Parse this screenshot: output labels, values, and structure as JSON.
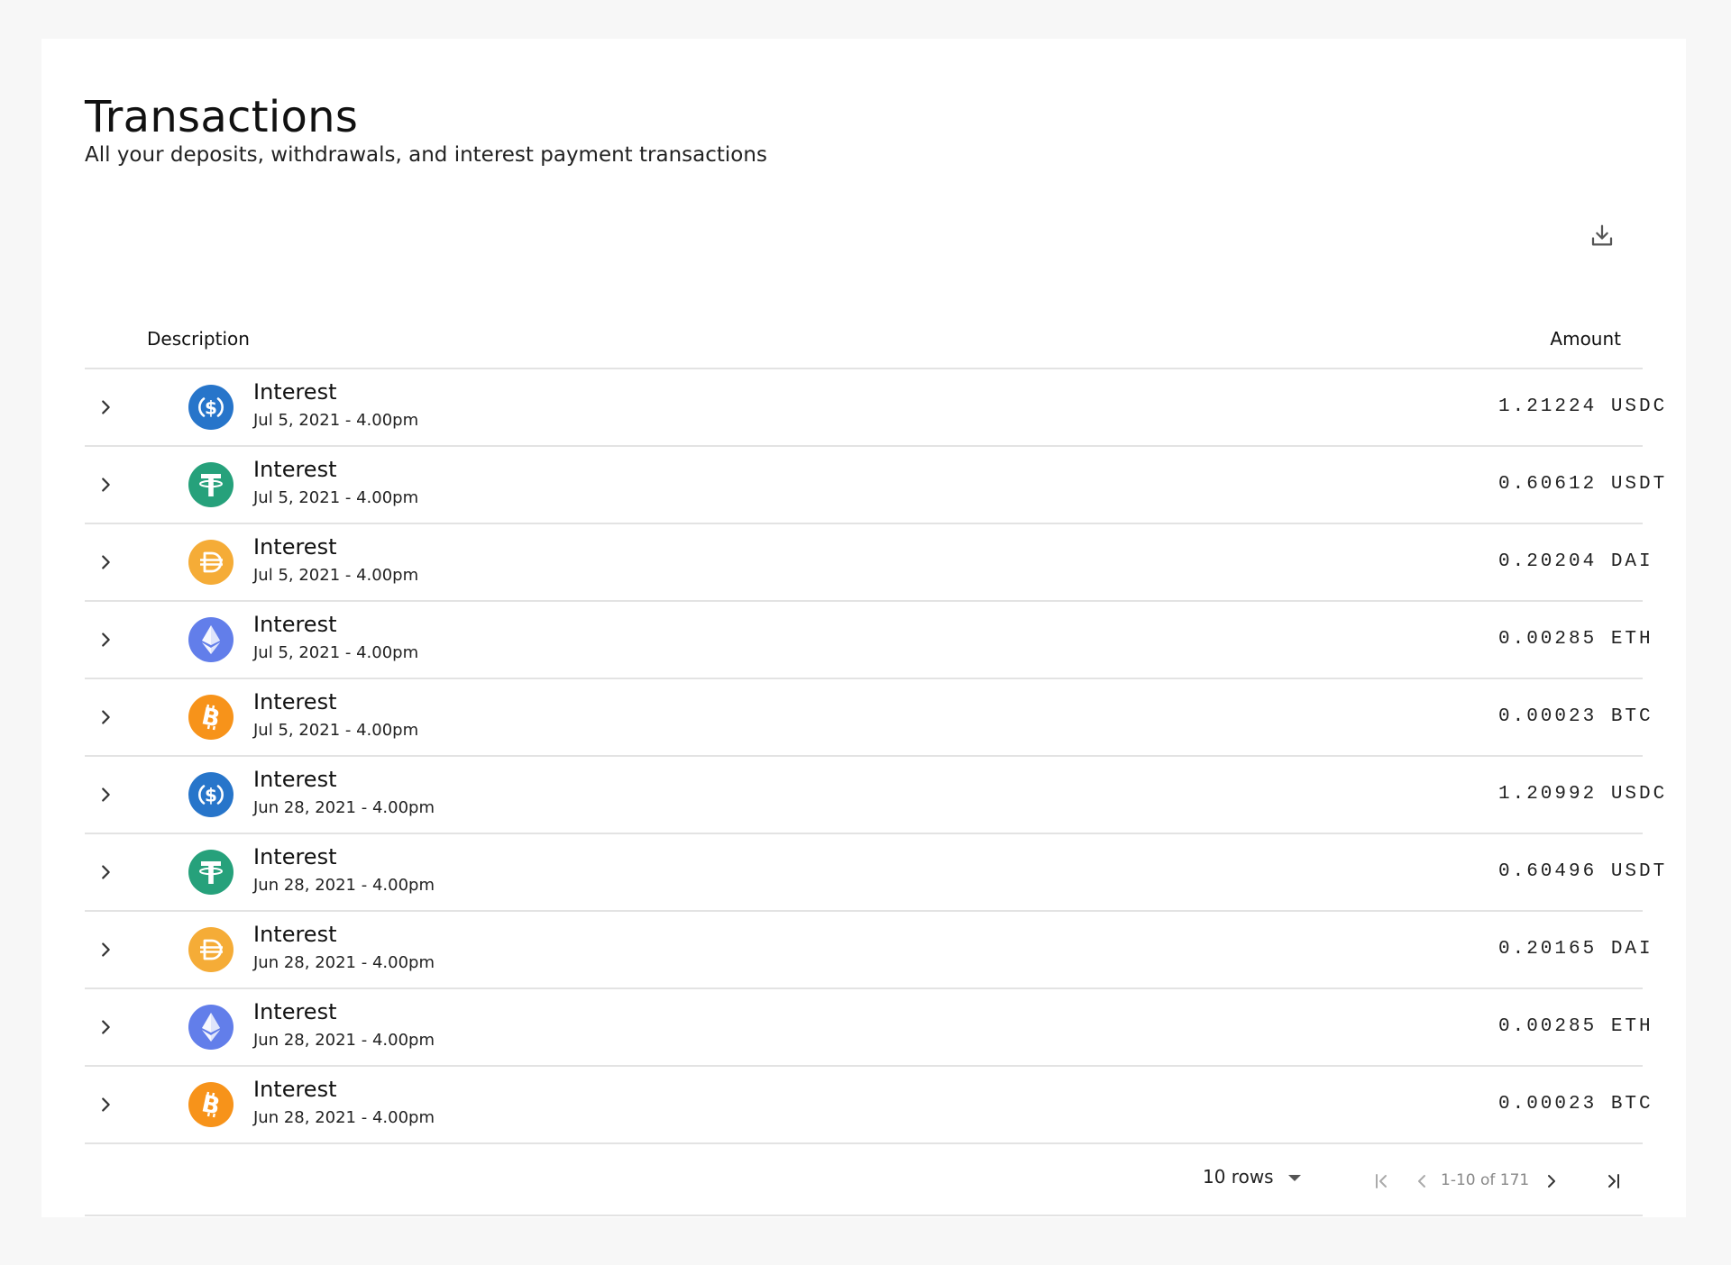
{
  "header": {
    "title": "Transactions",
    "subtitle": "All your deposits, withdrawals, and interest payment transactions"
  },
  "toolbar": {
    "download_icon": "download-icon"
  },
  "table": {
    "columns": {
      "description": "Description",
      "amount": "Amount"
    },
    "rows": [
      {
        "title": "Interest",
        "date": "Jul 5, 2021 - 4.00pm",
        "amount": "1.21224",
        "currency": "USDC",
        "icon": "usdc-icon"
      },
      {
        "title": "Interest",
        "date": "Jul 5, 2021 - 4.00pm",
        "amount": "0.60612",
        "currency": "USDT",
        "icon": "usdt-icon"
      },
      {
        "title": "Interest",
        "date": "Jul 5, 2021 - 4.00pm",
        "amount": "0.20204",
        "currency": "DAI",
        "icon": "dai-icon"
      },
      {
        "title": "Interest",
        "date": "Jul 5, 2021 - 4.00pm",
        "amount": "0.00285",
        "currency": "ETH",
        "icon": "eth-icon"
      },
      {
        "title": "Interest",
        "date": "Jul 5, 2021 - 4.00pm",
        "amount": "0.00023",
        "currency": "BTC",
        "icon": "btc-icon"
      },
      {
        "title": "Interest",
        "date": "Jun 28, 2021 - 4.00pm",
        "amount": "1.20992",
        "currency": "USDC",
        "icon": "usdc-icon"
      },
      {
        "title": "Interest",
        "date": "Jun 28, 2021 - 4.00pm",
        "amount": "0.60496",
        "currency": "USDT",
        "icon": "usdt-icon"
      },
      {
        "title": "Interest",
        "date": "Jun 28, 2021 - 4.00pm",
        "amount": "0.20165",
        "currency": "DAI",
        "icon": "dai-icon"
      },
      {
        "title": "Interest",
        "date": "Jun 28, 2021 - 4.00pm",
        "amount": "0.00285",
        "currency": "ETH",
        "icon": "eth-icon"
      },
      {
        "title": "Interest",
        "date": "Jun 28, 2021 - 4.00pm",
        "amount": "0.00023",
        "currency": "BTC",
        "icon": "btc-icon"
      }
    ]
  },
  "pagination": {
    "rows_per_page": "10 rows",
    "range": "1-10 of 171"
  },
  "colors": {
    "usdc": "#2775CA",
    "usdt": "#26A17B",
    "dai": "#F5AC37",
    "eth": "#627EEA",
    "btc": "#F7931A",
    "divider": "#e3e3e3"
  }
}
